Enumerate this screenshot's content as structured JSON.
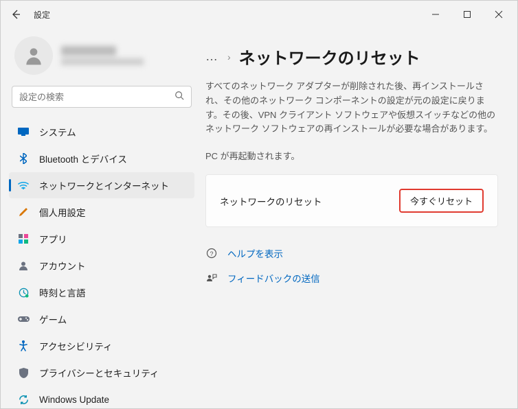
{
  "window": {
    "title": "設定"
  },
  "search": {
    "placeholder": "設定の検索"
  },
  "sidebar": {
    "items": [
      {
        "label": "システム",
        "icon": "system"
      },
      {
        "label": "Bluetooth とデバイス",
        "icon": "bluetooth"
      },
      {
        "label": "ネットワークとインターネット",
        "icon": "wifi",
        "active": true
      },
      {
        "label": "個人用設定",
        "icon": "brush"
      },
      {
        "label": "アプリ",
        "icon": "apps"
      },
      {
        "label": "アカウント",
        "icon": "account"
      },
      {
        "label": "時刻と言語",
        "icon": "time"
      },
      {
        "label": "ゲーム",
        "icon": "game"
      },
      {
        "label": "アクセシビリティ",
        "icon": "accessibility"
      },
      {
        "label": "プライバシーとセキュリティ",
        "icon": "privacy"
      },
      {
        "label": "Windows Update",
        "icon": "update"
      }
    ]
  },
  "breadcrumb": {
    "more": "…",
    "sep": "›",
    "title": "ネットワークのリセット"
  },
  "main": {
    "description": "すべてのネットワーク アダプターが削除された後、再インストールされ、その他のネットワーク コンポーネントの設定が元の設定に戻ります。その後、VPN クライアント ソフトウェアや仮想スイッチなどの他のネットワーク ソフトウェアの再インストールが必要な場合があります。",
    "restart_note": "PC が再起動されます。",
    "card_label": "ネットワークのリセット",
    "reset_button": "今すぐリセット",
    "help_link": "ヘルプを表示",
    "feedback_link": "フィードバックの送信"
  },
  "colors": {
    "accent": "#0067c0",
    "highlight_border": "#e03a2f"
  }
}
